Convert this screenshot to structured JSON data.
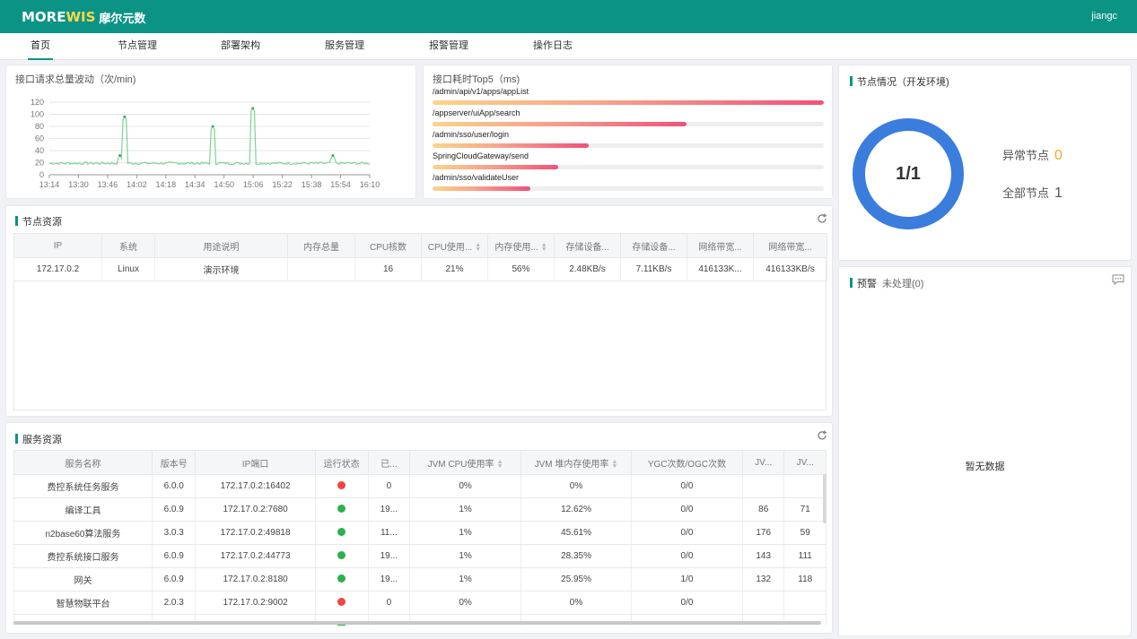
{
  "app": {
    "logo_text_a": "MORE",
    "logo_text_b": "WIS",
    "logo_cn": "摩尔元数",
    "user": "jiangc"
  },
  "nav": [
    "首页",
    "节点管理",
    "部署架构",
    "服务管理",
    "报警管理",
    "操作日志"
  ],
  "request_chart": {
    "title": "接口请求总量波动（次/min)",
    "chart_data": {
      "type": "line",
      "title": "接口请求总量波动（次/min)",
      "x": [
        "13:14",
        "13:30",
        "13:46",
        "14:02",
        "14:18",
        "14:34",
        "14:50",
        "15:06",
        "15:22",
        "15:38",
        "15:54",
        "16:10"
      ],
      "yticks": [
        0,
        20,
        40,
        60,
        80,
        100,
        120
      ],
      "ylim": [
        0,
        120
      ],
      "baseline": 19,
      "peaks": [
        {
          "at": 0.22,
          "value": 32
        },
        {
          "at": 0.235,
          "value": 96
        },
        {
          "at": 0.51,
          "value": 80
        },
        {
          "at": 0.635,
          "value": 110
        },
        {
          "at": 0.885,
          "value": 32
        }
      ],
      "color": "#7fd394",
      "grid": true
    }
  },
  "top5": {
    "title": "接口耗时Top5（ms)",
    "chart_data": {
      "type": "bar",
      "categories": [
        "/admin/api/v1/apps/appList",
        "/appserver/uiApp/search",
        "/admin/sso/user/login",
        "SpringCloudGateway/send",
        "/admin/sso/validateUser"
      ],
      "values": [
        100,
        65,
        40,
        32,
        25
      ]
    }
  },
  "node_resource": {
    "title": "节点资源",
    "columns": [
      "IP",
      "系统",
      "用途说明",
      "内存总量",
      "CPU核数",
      "CPU使用...",
      "内存使用...",
      "存储设备...",
      "存储设备...",
      "网络带宽...",
      "网络带宽..."
    ],
    "rows": [
      [
        "172.17.0.2",
        "Linux",
        "演示环境",
        "",
        "16",
        "21%",
        "56%",
        "2.48KB/s",
        "7.11KB/s",
        "416133K...",
        "416133KB/s"
      ]
    ]
  },
  "service_resource": {
    "title": "服务资源",
    "columns": [
      "服务名称",
      "版本号",
      "IP端口",
      "运行状态",
      "已...",
      "JVM CPU使用率",
      "JVM 堆内存使用率",
      "YGC次数/OGC次数",
      "JV...",
      "JV..."
    ],
    "rows": [
      {
        "name": "费控系统任务服务",
        "version": "6.0.0",
        "ip": "172.17.0.2:16402",
        "status": "red",
        "c5": "0",
        "cpu": "0%",
        "heap": "0%",
        "gc": "0/0",
        "j1": "",
        "j2": ""
      },
      {
        "name": "编译工具",
        "version": "6.0.9",
        "ip": "172.17.0.2:7680",
        "status": "green",
        "c5": "19...",
        "cpu": "1%",
        "heap": "12.62%",
        "gc": "0/0",
        "j1": "86",
        "j2": "71"
      },
      {
        "name": "n2base60算法服务",
        "version": "3.0.3",
        "ip": "172.17.0.2:49818",
        "status": "green",
        "c5": "11...",
        "cpu": "1%",
        "heap": "45.61%",
        "gc": "0/0",
        "j1": "176",
        "j2": "59"
      },
      {
        "name": "费控系统接口服务",
        "version": "6.0.9",
        "ip": "172.17.0.2:44773",
        "status": "green",
        "c5": "19...",
        "cpu": "1%",
        "heap": "28.35%",
        "gc": "0/0",
        "j1": "143",
        "j2": "111"
      },
      {
        "name": "网关",
        "version": "6.0.9",
        "ip": "172.17.0.2:8180",
        "status": "green",
        "c5": "19...",
        "cpu": "1%",
        "heap": "25.95%",
        "gc": "1/0",
        "j1": "132",
        "j2": "118"
      },
      {
        "name": "智慧物联平台",
        "version": "2.0.3",
        "ip": "172.17.0.2:9002",
        "status": "red",
        "c5": "0",
        "cpu": "0%",
        "heap": "0%",
        "gc": "0/0",
        "j1": "",
        "j2": ""
      }
    ],
    "status_colors": {
      "red": "#f0463f",
      "green": "#2bb24c"
    }
  },
  "node_status": {
    "title": "节点情况（开发环境)",
    "ratio": "1/1",
    "abnormal_label": "异常节点",
    "abnormal_value": "0",
    "total_label": "全部节点",
    "total_value": "1",
    "ring_color": "#3b7ddd",
    "abnormal_color": "#f5a623"
  },
  "alarm": {
    "title": "预警",
    "sub": "未处理(0)",
    "empty": "暂无数据"
  }
}
